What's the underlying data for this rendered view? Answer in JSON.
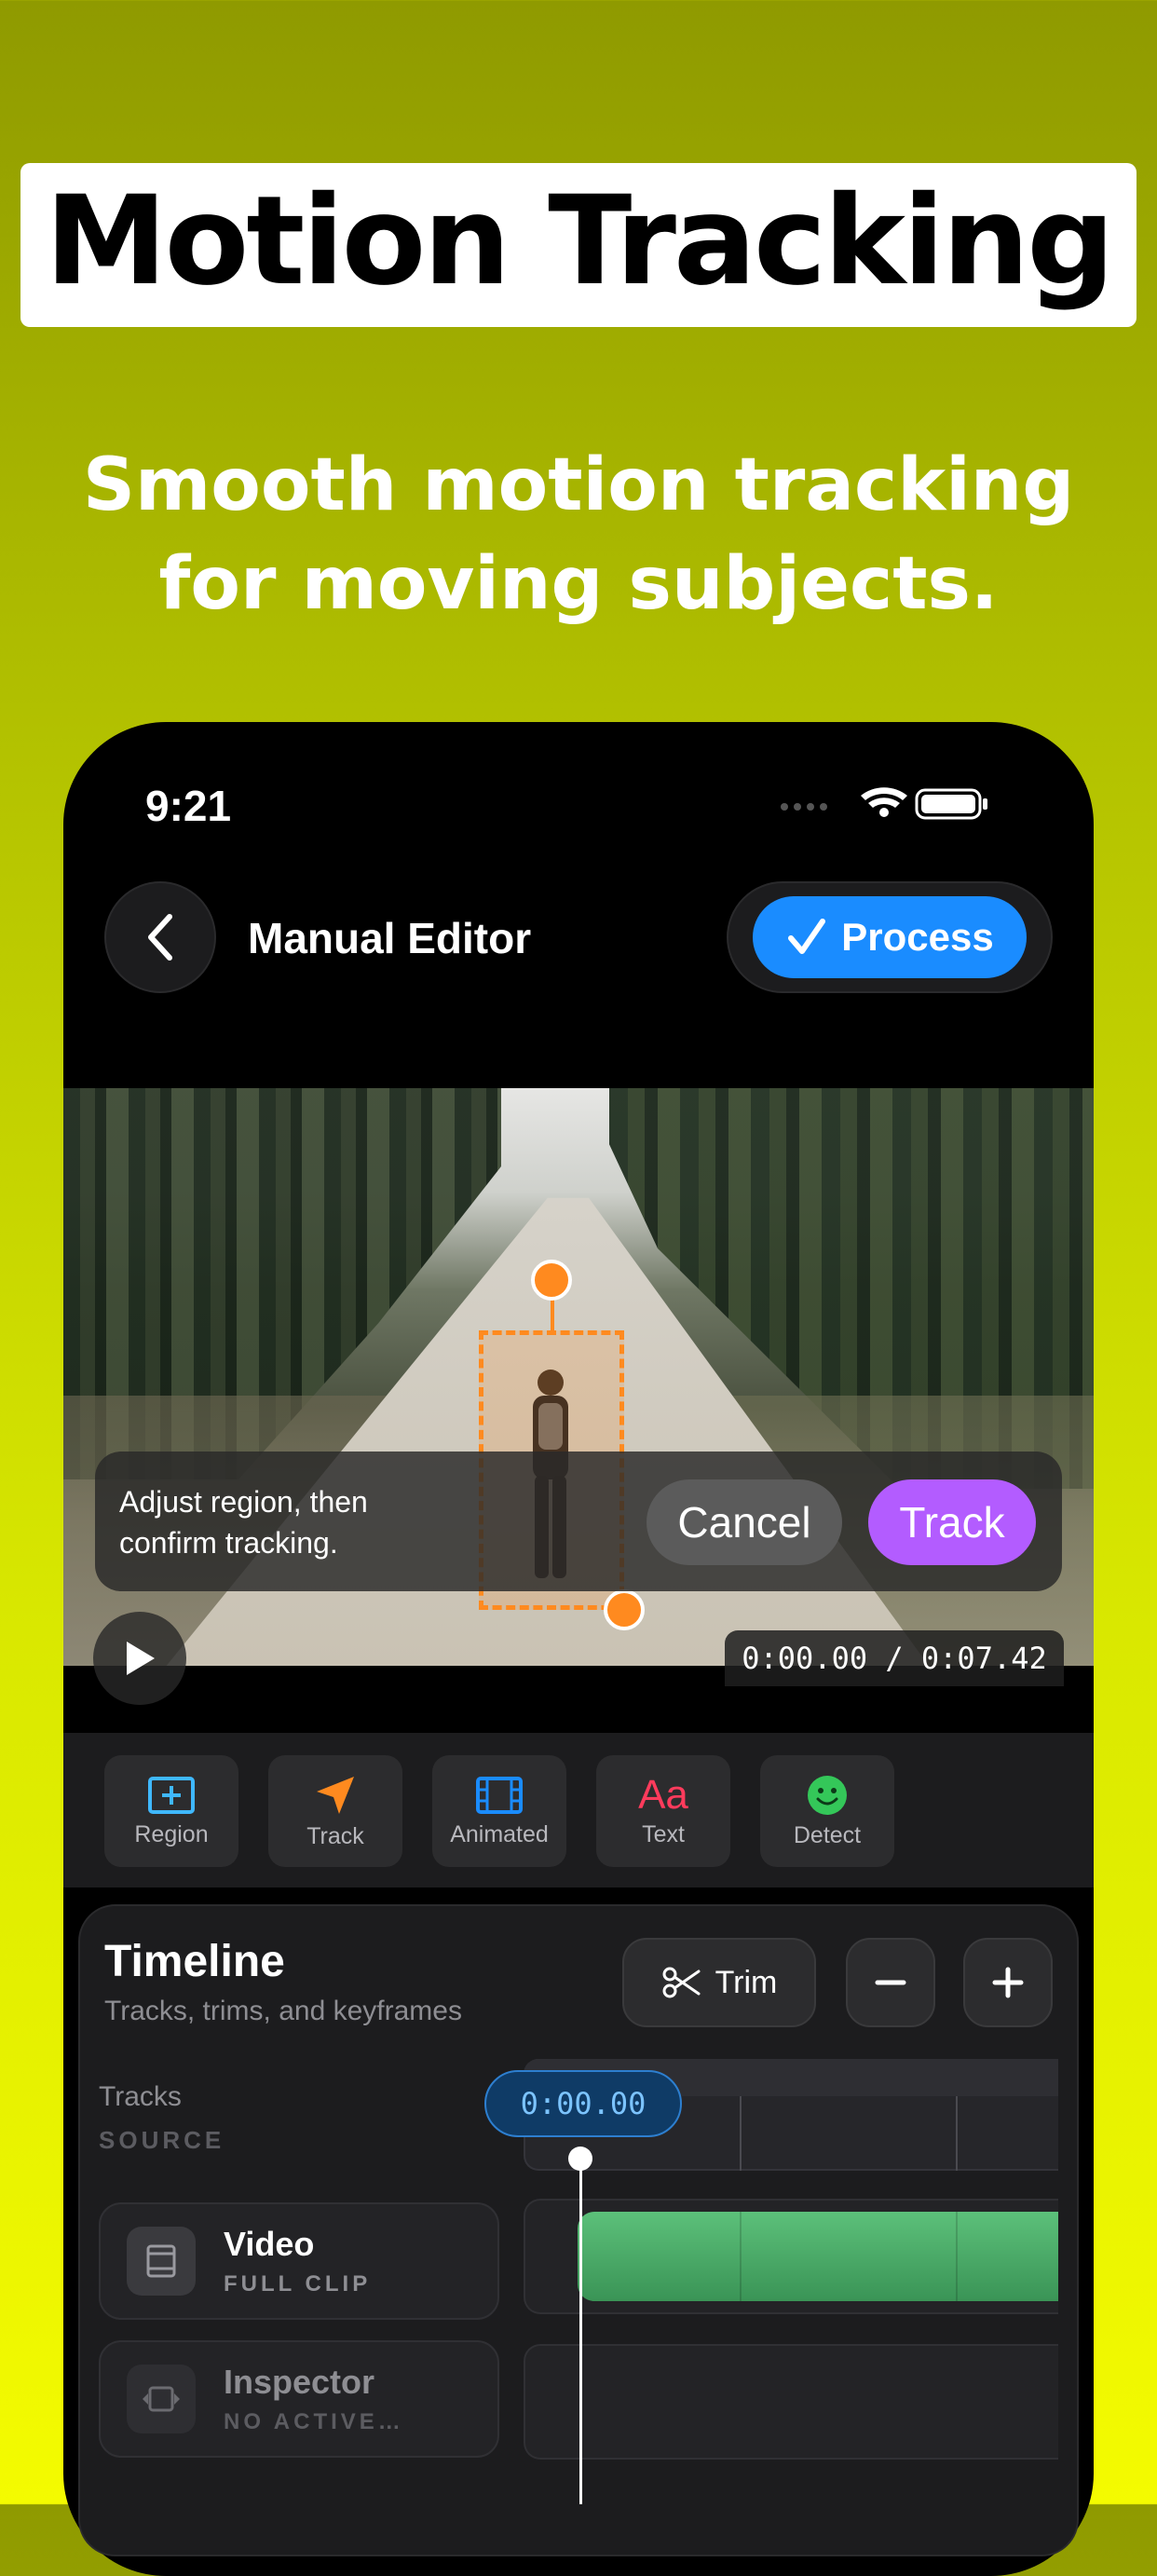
{
  "promo": {
    "headline": "Motion Tracking",
    "subheadline": "Smooth motion tracking for moving subjects."
  },
  "status_bar": {
    "time": "9:21"
  },
  "nav": {
    "title": "Manual Editor",
    "process_label": "Process"
  },
  "video": {
    "hint": "Adjust region, then confirm tracking.",
    "cancel_label": "Cancel",
    "track_label": "Track",
    "timecode": "0:00.00 / 0:07.42"
  },
  "tools": [
    {
      "label": "Region",
      "icon": "plus-square-icon",
      "color": "#3fb8ff"
    },
    {
      "label": "Track",
      "icon": "location-arrow-icon",
      "color": "#ff8a1f"
    },
    {
      "label": "Animated",
      "icon": "film-icon",
      "color": "#1a8cff"
    },
    {
      "label": "Text",
      "icon": "text-aa-icon",
      "color": "#ff3b5c"
    },
    {
      "label": "Detect",
      "icon": "smiley-icon",
      "color": "#34c759"
    }
  ],
  "timeline": {
    "title": "Timeline",
    "subtitle": "Tracks, trims, and keyframes",
    "trim_label": "Trim",
    "tracks_label": "Tracks",
    "source_label": "SOURCE",
    "playhead": "0:00.00",
    "rows": [
      {
        "name": "Video",
        "sub": "FULL CLIP"
      },
      {
        "name": "Inspector",
        "sub": "NO ACTIVE…"
      }
    ]
  },
  "colors": {
    "accent_blue": "#1a8cff",
    "track_purple": "#b35cff",
    "selection_orange": "#ff8a1f",
    "clip_green": "#4caf6a"
  }
}
